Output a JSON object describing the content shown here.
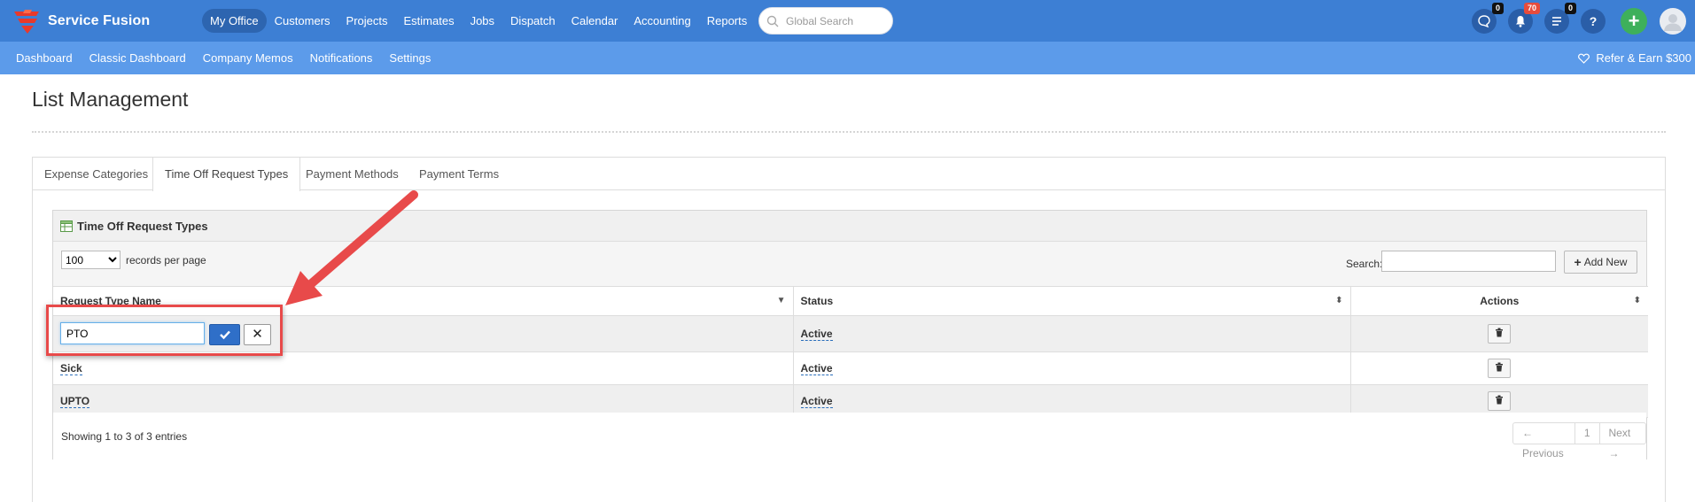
{
  "app": {
    "name": "Service Fusion",
    "brand_color": "#3d7fd4",
    "subbar_color": "#5c9bea"
  },
  "topnav": {
    "items": [
      {
        "label": "My Office",
        "active": true
      },
      {
        "label": "Customers"
      },
      {
        "label": "Projects"
      },
      {
        "label": "Estimates"
      },
      {
        "label": "Jobs"
      },
      {
        "label": "Dispatch"
      },
      {
        "label": "Calendar"
      },
      {
        "label": "Accounting"
      },
      {
        "label": "Reports"
      }
    ],
    "search_placeholder": "Global Search",
    "icons": [
      {
        "name": "chat-icon",
        "badge": "0"
      },
      {
        "name": "bell-icon",
        "badge": "70",
        "badge_color": "#e74c3c"
      },
      {
        "name": "tasks-icon",
        "badge": "0"
      },
      {
        "name": "help-icon",
        "glyph": "?"
      },
      {
        "name": "plus-icon",
        "glyph": "+"
      },
      {
        "name": "avatar"
      }
    ]
  },
  "subnav": {
    "items": [
      "Dashboard",
      "Classic Dashboard",
      "Company Memos",
      "Notifications",
      "Settings"
    ],
    "refer": "Refer & Earn $300"
  },
  "page": {
    "title": "List Management"
  },
  "tabs": [
    {
      "label": "Expense Categories"
    },
    {
      "label": "Time Off Request Types",
      "active": true
    },
    {
      "label": "Payment Methods"
    },
    {
      "label": "Payment Terms"
    }
  ],
  "widget": {
    "title": "Time Off Request Types",
    "records_per_page": {
      "value": "100",
      "label": "records per page"
    },
    "search_label": "Search:",
    "add_new": "Add New",
    "columns": [
      "Request Type Name",
      "Status",
      "Actions"
    ],
    "rows": [
      {
        "name": "PTO",
        "status": "Active",
        "editing": true,
        "edit_value": "PTO"
      },
      {
        "name": "Sick",
        "status": "Active"
      },
      {
        "name": "UPTO",
        "status": "Active"
      }
    ],
    "info": "Showing 1 to 3 of 3 entries",
    "pager": {
      "prev": "← Previous",
      "page": "1",
      "next": "Next →"
    }
  },
  "annotation": {
    "color": "#e84a4a"
  }
}
